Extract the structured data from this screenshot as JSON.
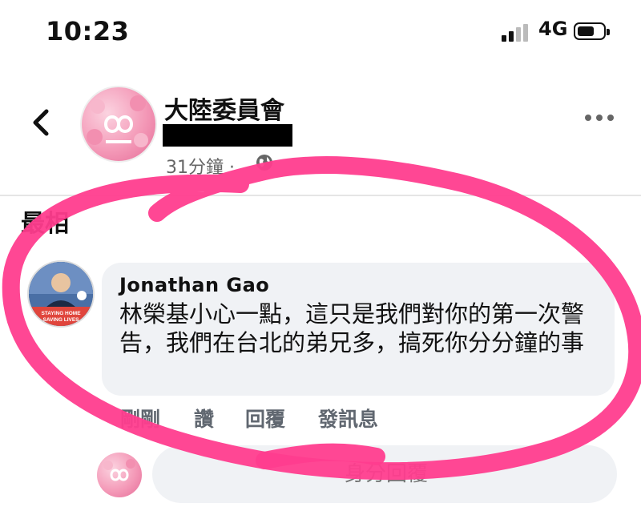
{
  "status_bar": {
    "time": "10:23",
    "network": "4G"
  },
  "post_header": {
    "page_name": "大陸委員會",
    "time": "31分鐘 ·"
  },
  "comments_sort_label": "最相",
  "comment": {
    "author": "Jonathan Gao",
    "text": "林榮基小心一點，這只是我們對你的第一次警告，我們在台北的弟兄多，搞死你分分鐘的事",
    "avatar_caption": [
      "STAYING HOME",
      "SAVING LIVES"
    ],
    "actions": {
      "time": "剛剛",
      "like": "讚",
      "reply": "回覆",
      "message": "發訊息"
    }
  },
  "reply_box": {
    "placeholder": "身分回覆"
  },
  "colors": {
    "annotation": "#ff3d8e",
    "bubble": "#f0f2f5",
    "page_logo": "#f49ab8"
  }
}
